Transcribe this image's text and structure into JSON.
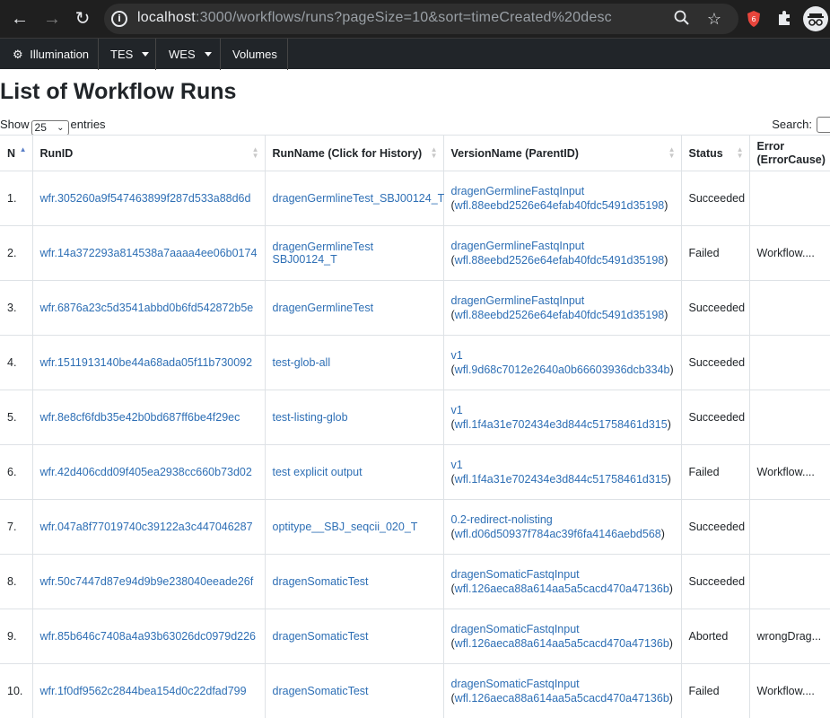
{
  "browser": {
    "url_host": "localhost",
    "url_rest": ":3000/workflows/runs?pageSize=10&sort=timeCreated%20desc"
  },
  "navbar": {
    "brand": "Illumination",
    "items": [
      {
        "label": "TES"
      },
      {
        "label": "WES"
      },
      {
        "label": "Volumes"
      }
    ]
  },
  "page": {
    "title": "List of Workflow Runs",
    "show_label": "Show",
    "page_size": "25",
    "entries_label": "entries",
    "search_label": "Search:"
  },
  "table": {
    "columns": [
      "N",
      "RunID",
      "RunName (Click for History)",
      "VersionName (ParentID)",
      "Status",
      "Error (ErrorCause)"
    ],
    "rows": [
      {
        "n": "1.",
        "run_id": "wfr.305260a9f547463899f287d533a88d6d",
        "run_name": "dragenGermlineTest_SBJ00124_T",
        "version": "dragenGermlineFastqInput",
        "parent": "wfl.88eebd2526e64efab40fdc5491d35198",
        "status": "Succeeded",
        "error": ""
      },
      {
        "n": "2.",
        "run_id": "wfr.14a372293a814538a7aaaa4ee06b0174",
        "run_name": "dragenGermlineTest SBJ00124_T",
        "version": "dragenGermlineFastqInput",
        "parent": "wfl.88eebd2526e64efab40fdc5491d35198",
        "status": "Failed",
        "error": "Workflow...."
      },
      {
        "n": "3.",
        "run_id": "wfr.6876a23c5d3541abbd0b6fd542872b5e",
        "run_name": "dragenGermlineTest",
        "version": "dragenGermlineFastqInput",
        "parent": "wfl.88eebd2526e64efab40fdc5491d35198",
        "status": "Succeeded",
        "error": ""
      },
      {
        "n": "4.",
        "run_id": "wfr.1511913140be44a68ada05f11b730092",
        "run_name": "test-glob-all",
        "version": "v1",
        "parent": "wfl.9d68c7012e2640a0b66603936dcb334b",
        "status": "Succeeded",
        "error": ""
      },
      {
        "n": "5.",
        "run_id": "wfr.8e8cf6fdb35e42b0bd687ff6be4f29ec",
        "run_name": "test-listing-glob",
        "version": "v1",
        "parent": "wfl.1f4a31e702434e3d844c51758461d315",
        "status": "Succeeded",
        "error": ""
      },
      {
        "n": "6.",
        "run_id": "wfr.42d406cdd09f405ea2938cc660b73d02",
        "run_name": "test explicit output",
        "version": "v1",
        "parent": "wfl.1f4a31e702434e3d844c51758461d315",
        "status": "Failed",
        "error": "Workflow...."
      },
      {
        "n": "7.",
        "run_id": "wfr.047a8f77019740c39122a3c447046287",
        "run_name": "optitype__SBJ_seqcii_020_T",
        "version": "0.2-redirect-nolisting",
        "parent": "wfl.d06d50937f784ac39f6fa4146aebd568",
        "status": "Succeeded",
        "error": ""
      },
      {
        "n": "8.",
        "run_id": "wfr.50c7447d87e94d9b9e238040eeade26f",
        "run_name": "dragenSomaticTest",
        "version": "dragenSomaticFastqInput",
        "parent": "wfl.126aeca88a614aa5a5cacd470a47136b",
        "status": "Succeeded",
        "error": ""
      },
      {
        "n": "9.",
        "run_id": "wfr.85b646c7408a4a93b63026dc0979d226",
        "run_name": "dragenSomaticTest",
        "version": "dragenSomaticFastqInput",
        "parent": "wfl.126aeca88a614aa5a5cacd470a47136b",
        "status": "Aborted",
        "error": "wrongDrag..."
      },
      {
        "n": "10.",
        "run_id": "wfr.1f0df9562c2844bea154d0c22dfad799",
        "run_name": "dragenSomaticTest",
        "version": "dragenSomaticFastqInput",
        "parent": "wfl.126aeca88a614aa5a5cacd470a47136b",
        "status": "Failed",
        "error": "Workflow...."
      }
    ]
  }
}
